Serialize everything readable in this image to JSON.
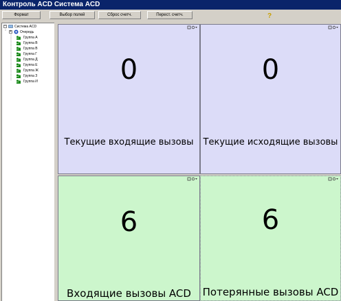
{
  "window": {
    "title": "Контроль ACD Система ACD"
  },
  "toolbar": {
    "format_label": "Формат",
    "fields_label": "Выбор полей",
    "reset_label": "Сброс счетч.",
    "recalc_label": "Перест. счетч."
  },
  "tree": {
    "root": "Система ACD",
    "queue": "Очередь",
    "groups": [
      "Группа A",
      "Группа B",
      "Группа B",
      "Группа Г",
      "Группа Д",
      "Группа Е",
      "Группа Ж",
      "Группа З",
      "Группа И"
    ]
  },
  "tiles": [
    {
      "value": "0",
      "label": "Текущие входящие вызовы"
    },
    {
      "value": "0",
      "label": "Текущие исходящие вызовы"
    },
    {
      "value": "6",
      "label": "Входящие вызовы ACD"
    },
    {
      "value": "6",
      "label": "Потерянные вызовы ACD"
    }
  ],
  "colors": {
    "tile_current": "#dcdcf8",
    "tile_acd": "#ccf6cc",
    "titlebar": "#0a246a"
  },
  "icons": [
    "help-icon",
    "system-icon",
    "queue-icon",
    "group-icon",
    "tile-copy-icon",
    "tile-settings-icon"
  ]
}
